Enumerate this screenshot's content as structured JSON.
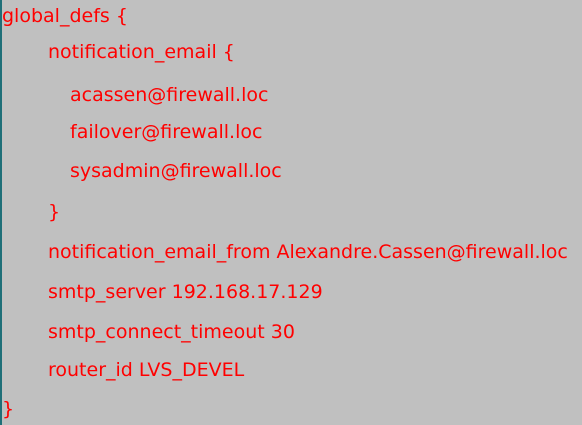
{
  "code": {
    "lines": [
      "global_defs {",
      "notification_email {",
      "acassen@firewall.loc",
      "failover@firewall.loc",
      "sysadmin@firewall.loc",
      "}",
      "notification_email_from Alexandre.Cassen@firewall.loc",
      "smtp_server 192.168.17.129",
      "smtp_connect_timeout 30",
      "router_id LVS_DEVEL",
      "}"
    ]
  },
  "colors": {
    "background": "#c0c0c0",
    "text": "#ff0000",
    "border": "#1f6f78"
  }
}
